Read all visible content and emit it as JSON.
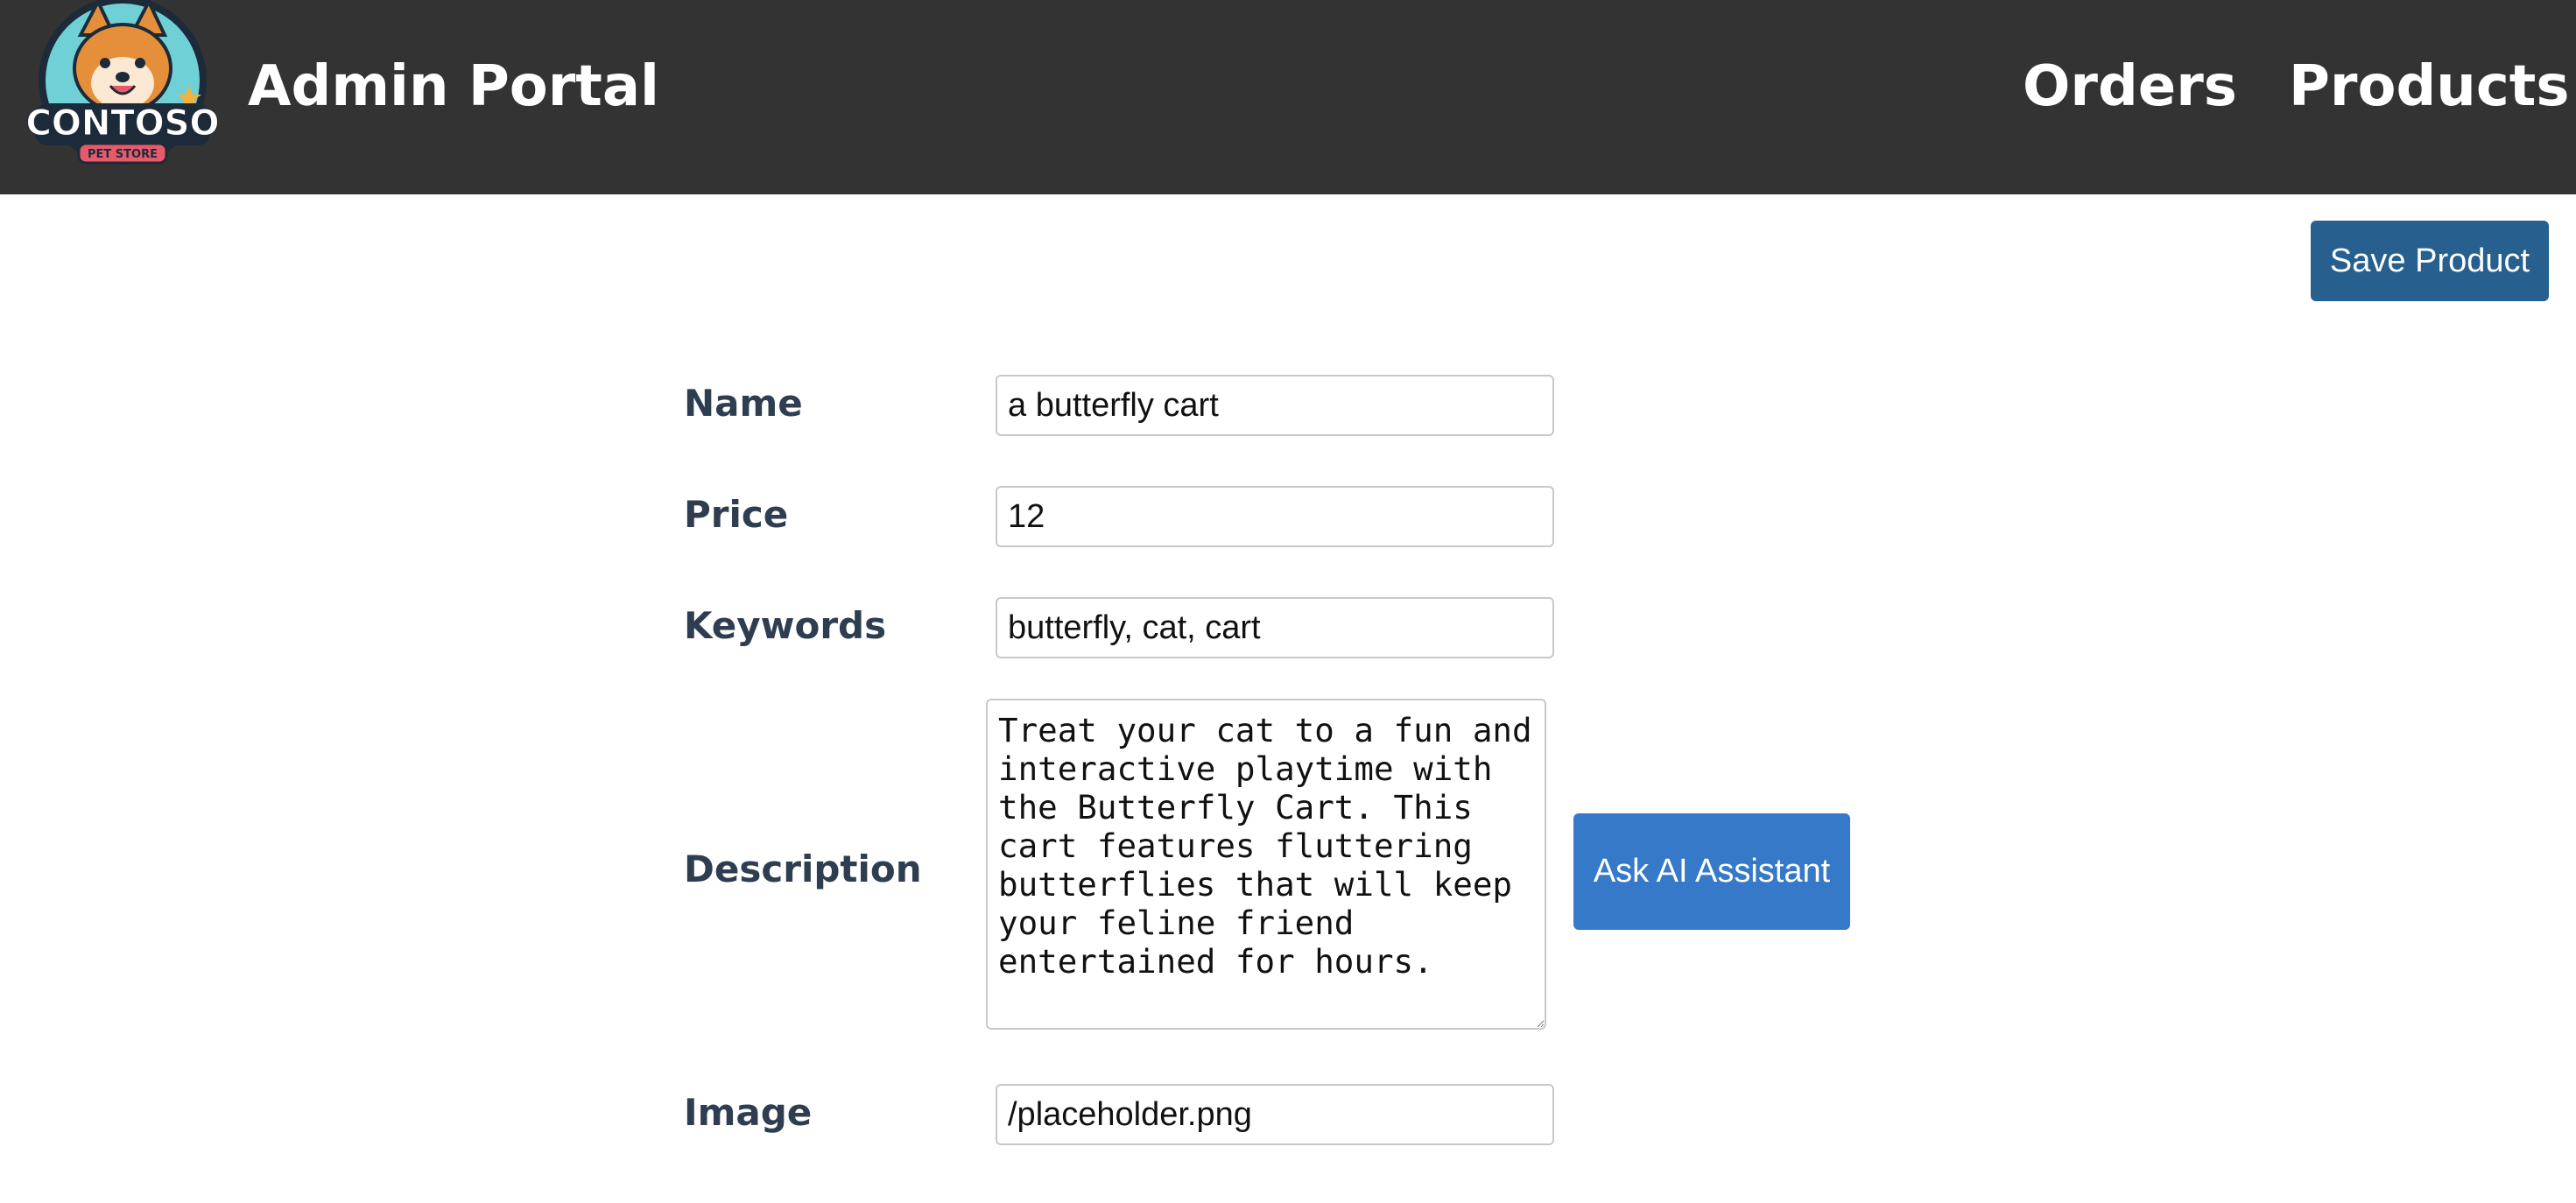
{
  "header": {
    "logo": {
      "brand_text": "CONTOSO",
      "sub_text": "PET STORE"
    },
    "title": "Admin Portal",
    "nav": [
      {
        "label": "Orders"
      },
      {
        "label": "Products"
      }
    ],
    "background_color": "#333333"
  },
  "toolbar": {
    "save_label": "Save Product",
    "save_color": "#27608f"
  },
  "form": {
    "name": {
      "label": "Name",
      "value": "a butterfly cart"
    },
    "price": {
      "label": "Price",
      "value": "12"
    },
    "keywords": {
      "label": "Keywords",
      "value": "butterfly, cat, cart"
    },
    "description": {
      "label": "Description",
      "value": "Treat your cat to a fun and interactive playtime with the Butterfly Cart. This cart features fluttering butterflies that will keep your feline friend entertained for hours."
    },
    "image": {
      "label": "Image",
      "value": "/placeholder.png"
    },
    "ai_assistant_label": "Ask AI Assistant",
    "ai_assistant_color": "#3579c8",
    "label_color": "#2e3e50"
  }
}
